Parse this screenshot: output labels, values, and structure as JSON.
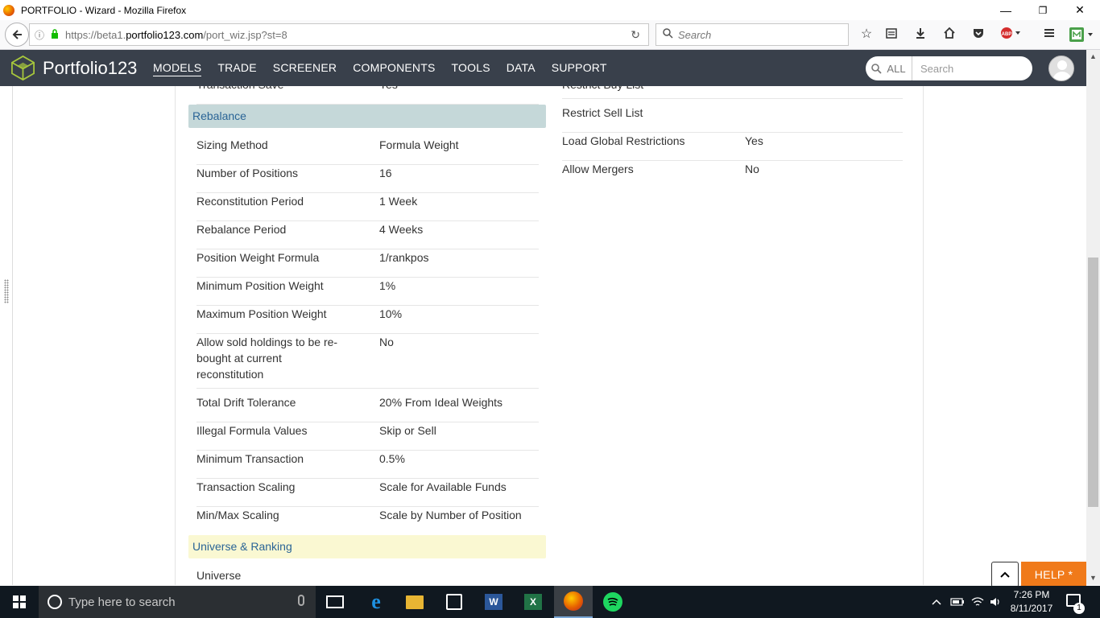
{
  "window": {
    "title": "PORTFOLIO - Wizard - Mozilla Firefox",
    "minimize": "—",
    "restore": "❐",
    "close": "✕"
  },
  "browser": {
    "url_prefix": "https://beta1.",
    "url_host": "portfolio123.com",
    "url_path": "/port_wiz.jsp?st=8",
    "search_placeholder": "Search"
  },
  "site": {
    "brand": "Portfolio123",
    "nav": [
      "MODELS",
      "TRADE",
      "SCREENER",
      "COMPONENTS",
      "TOOLS",
      "DATA",
      "SUPPORT"
    ],
    "search_scope": "ALL",
    "search_placeholder": "Search"
  },
  "left_column": {
    "cut_row": {
      "label": "Transaction Save",
      "value": "Yes"
    },
    "rebalance_title": "Rebalance",
    "rows": [
      {
        "label": "Sizing Method",
        "value": "Formula Weight"
      },
      {
        "label": "Number of Positions",
        "value": "16"
      },
      {
        "label": "Reconstitution Period",
        "value": "1 Week"
      },
      {
        "label": "Rebalance Period",
        "value": "4 Weeks"
      },
      {
        "label": "Position Weight Formula",
        "value": "1/rankpos"
      },
      {
        "label": "Minimum Position Weight",
        "value": "1%"
      },
      {
        "label": "Maximum Position Weight",
        "value": "10%"
      },
      {
        "label": "Allow sold holdings to be re-bought at current reconstitution",
        "value": "No"
      },
      {
        "label": "Total Drift Tolerance",
        "value": "20% From Ideal Weights"
      },
      {
        "label": "Illegal Formula Values",
        "value": "Skip or Sell"
      },
      {
        "label": "Minimum Transaction",
        "value": "0.5%"
      },
      {
        "label": "Transaction Scaling",
        "value": "Scale for Available Funds"
      },
      {
        "label": "Min/Max Scaling",
        "value": "Scale by Number of Position"
      }
    ],
    "universe_title": "Universe & Ranking",
    "universe_row": {
      "label": "Universe",
      "value": ""
    }
  },
  "right_column": {
    "cut_row": {
      "label": "Restrict Buy List",
      "value": ""
    },
    "rows": [
      {
        "label": "Restrict Sell List",
        "value": ""
      },
      {
        "label": "Load Global Restrictions",
        "value": "Yes"
      },
      {
        "label": "Allow Mergers",
        "value": "No"
      }
    ]
  },
  "widgets": {
    "scroll_up": "⌃",
    "help_label": "HELP *"
  },
  "taskbar": {
    "search_placeholder": "Type here to search",
    "word_label": "W",
    "excel_label": "X",
    "time": "7:26 PM",
    "date": "8/11/2017",
    "notification_count": "1"
  }
}
